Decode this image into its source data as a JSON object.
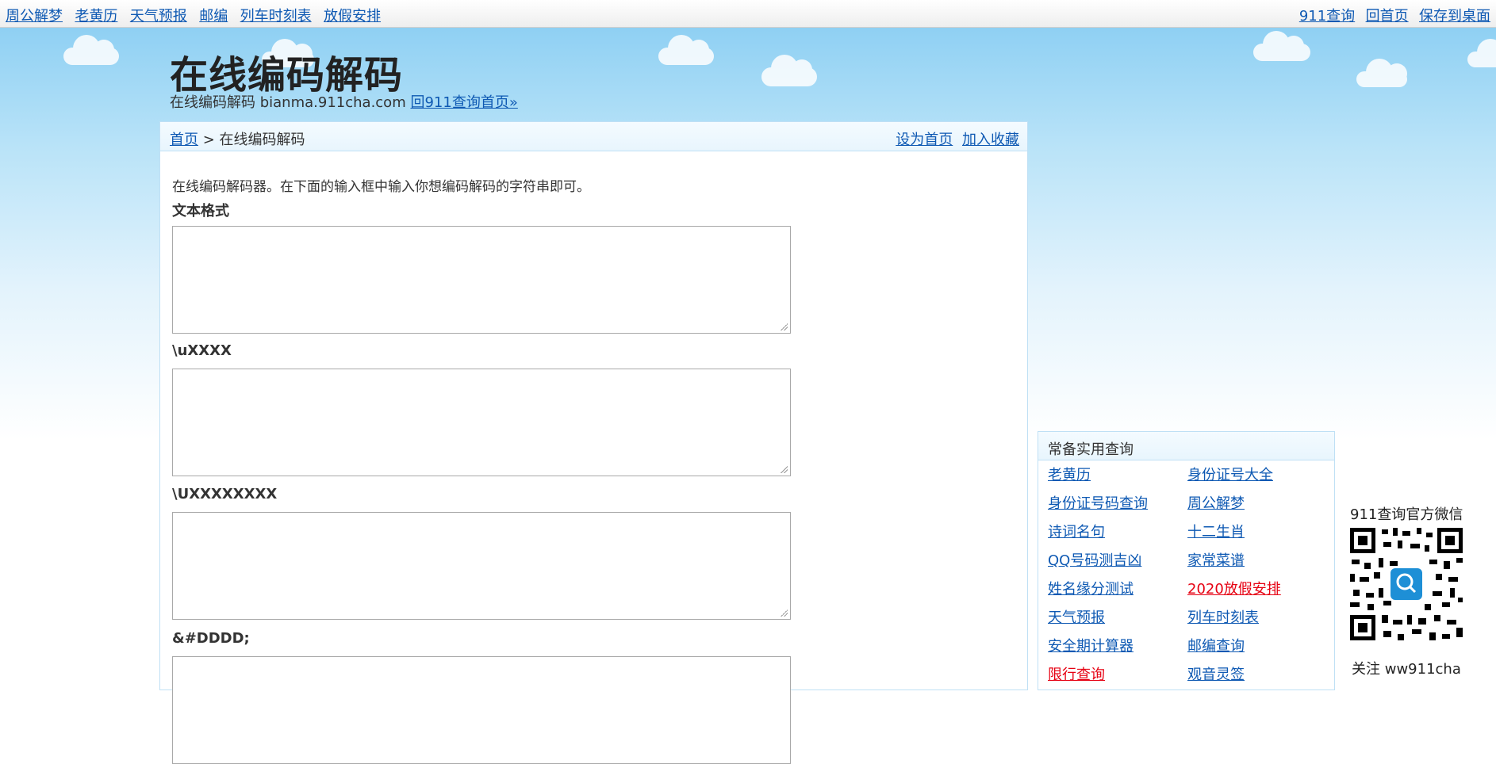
{
  "topnav": {
    "left": [
      "周公解梦",
      "老黄历",
      "天气预报",
      "邮编",
      "列车时刻表",
      "放假安排"
    ],
    "right": [
      "911查询",
      "回首页",
      "保存到桌面"
    ]
  },
  "header": {
    "title": "在线编码解码",
    "subtitle": "在线编码解码 bianma.911cha.com",
    "home_link": "回911查询首页»"
  },
  "breadcrumb": {
    "home": "首页",
    "separator": " > ",
    "current": "在线编码解码",
    "set_home": "设为首页",
    "add_favorite": "加入收藏"
  },
  "main": {
    "intro": "在线编码解码器。在下面的输入框中输入你想编码解码的字符串即可。",
    "fields": [
      {
        "label": "文本格式",
        "value": ""
      },
      {
        "label": "\\uXXXX",
        "value": ""
      },
      {
        "label": "\\UXXXXXXXX",
        "value": ""
      },
      {
        "label": "&#DDDD;",
        "value": ""
      }
    ]
  },
  "sidebar": {
    "title": "常备实用查询",
    "links": [
      {
        "label": "老黄历",
        "highlight": false
      },
      {
        "label": "身份证号大全",
        "highlight": false
      },
      {
        "label": "身份证号码查询",
        "highlight": false
      },
      {
        "label": "周公解梦",
        "highlight": false
      },
      {
        "label": "诗词名句",
        "highlight": false
      },
      {
        "label": "十二生肖",
        "highlight": false
      },
      {
        "label": "QQ号码测吉凶",
        "highlight": false
      },
      {
        "label": "家常菜谱",
        "highlight": false
      },
      {
        "label": "姓名缘分测试",
        "highlight": false
      },
      {
        "label": "2020放假安排",
        "highlight": true
      },
      {
        "label": "天气预报",
        "highlight": false
      },
      {
        "label": "列车时刻表",
        "highlight": false
      },
      {
        "label": "安全期计算器",
        "highlight": false
      },
      {
        "label": "邮编查询",
        "highlight": false
      },
      {
        "label": "限行查询",
        "highlight": true
      },
      {
        "label": "观音灵签",
        "highlight": false
      }
    ]
  },
  "wechat": {
    "title": "911查询官方微信",
    "follow": "关注 ww911cha"
  },
  "colors": {
    "link": "#0e59b3",
    "highlight_link": "#e60012",
    "panel_border": "#bfe0f5",
    "sky": "#8fd0f3"
  }
}
